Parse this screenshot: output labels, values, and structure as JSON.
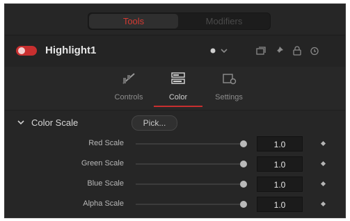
{
  "tabs": {
    "tools": "Tools",
    "modifiers": "Modifiers"
  },
  "node": {
    "name": "Highlight1"
  },
  "subtabs": [
    {
      "label": "Controls",
      "icon": "controls-icon"
    },
    {
      "label": "Color",
      "icon": "color-icon"
    },
    {
      "label": "Settings",
      "icon": "settings-icon"
    }
  ],
  "active_subtab": "Color",
  "section": {
    "title": "Color Scale",
    "pick_label": "Pick..."
  },
  "params": [
    {
      "label": "Red Scale",
      "value": "1.0"
    },
    {
      "label": "Green Scale",
      "value": "1.0"
    },
    {
      "label": "Blue Scale",
      "value": "1.0"
    },
    {
      "label": "Alpha Scale",
      "value": "1.0"
    }
  ],
  "colors": {
    "accent": "#c82f2f",
    "panel": "#282828"
  }
}
